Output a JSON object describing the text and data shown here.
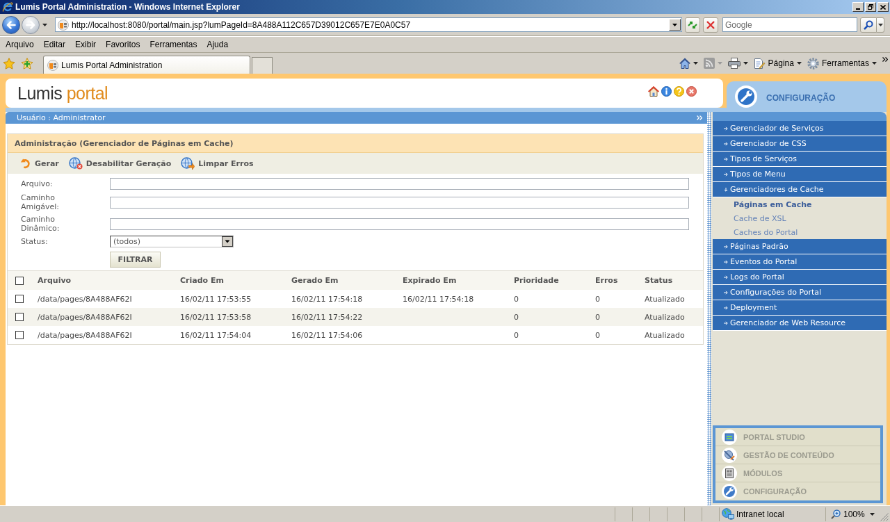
{
  "window": {
    "title": "Lumis Portal Administration - Windows Internet Explorer"
  },
  "address_bar": {
    "url": "http://localhost:8080/portal/main.jsp?lumPageId=8A488A112C657D39012C657E7E0A0C57"
  },
  "search_box": {
    "placeholder": "Google"
  },
  "menu_bar": [
    "Arquivo",
    "Editar",
    "Exibir",
    "Favoritos",
    "Ferramentas",
    "Ajuda"
  ],
  "tabs": [
    {
      "label": "Lumis Portal Administration",
      "selected": true
    }
  ],
  "command_bar": [
    "Página",
    "Ferramentas"
  ],
  "portal_header": {
    "logo": [
      "Lumis",
      "portal"
    ],
    "section": "CONFIGURAÇÃO"
  },
  "user_bar": {
    "text": "Usuário : Administrator"
  },
  "panel": {
    "title": "Administração (Gerenciador de Páginas em Cache)",
    "actions": [
      "Gerar",
      "Desabilitar Geração",
      "Limpar Erros"
    ],
    "filters": [
      {
        "kind": "text",
        "label": "Arquivo:"
      },
      {
        "kind": "text",
        "label": "Caminho Amigável:"
      },
      {
        "kind": "text",
        "label": "Caminho Dinâmico:"
      },
      {
        "kind": "select",
        "label": "Status:",
        "value": "(todos)"
      }
    ],
    "filter_button": "FILTRAR",
    "table": {
      "select_all": {
        "checked": false
      },
      "columns": [
        "Arquivo",
        "Criado Em",
        "Gerado Em",
        "Expirado Em",
        "Prioridade",
        "Erros",
        "Status"
      ],
      "rows": [
        {
          "checked": false,
          "file": "/data/pages/8A488AF62I",
          "created": "16/02/11 17:53:55",
          "generated": "16/02/11 17:54:18",
          "expires": "16/02/11 17:54:18",
          "priority": "0",
          "errors": "0",
          "status": "Atualizado"
        },
        {
          "checked": false,
          "file": "/data/pages/8A488AF62I",
          "created": "16/02/11 17:53:58",
          "generated": "16/02/11 17:54:22",
          "priority": "0",
          "errors": "0",
          "status": "Atualizado"
        },
        {
          "checked": false,
          "file": "/data/pages/8A488AF62I",
          "created": "16/02/11 17:54:04",
          "generated": "16/02/11 17:54:06",
          "priority": "0",
          "errors": "0",
          "status": "Atualizado"
        }
      ]
    }
  },
  "sidebar": {
    "items": [
      {
        "label": "Gerenciador de Serviços",
        "expanded": false
      },
      {
        "label": "Gerenciador de CSS",
        "expanded": false
      },
      {
        "label": "Tipos de Serviços",
        "expanded": false
      },
      {
        "label": "Tipos de Menu",
        "expanded": false
      },
      {
        "label": "Gerenciadores de Cache",
        "expanded": true,
        "children": [
          {
            "label": "Páginas em Cache",
            "selected": true
          },
          {
            "label": "Cache de XSL",
            "selected": false
          },
          {
            "label": "Caches do Portal",
            "selected": false
          }
        ]
      },
      {
        "label": "Páginas Padrão",
        "expanded": false
      },
      {
        "label": "Eventos do Portal",
        "expanded": false
      },
      {
        "label": "Logs do Portal",
        "expanded": false
      },
      {
        "label": "Configurações do Portal",
        "expanded": false
      },
      {
        "label": "Deployment",
        "expanded": false
      },
      {
        "label": "Gerenciador de Web Resource",
        "expanded": false
      }
    ]
  },
  "modules": [
    {
      "label": "PORTAL STUDIO"
    },
    {
      "label": "GESTÃO DE CONTEÚDO"
    },
    {
      "label": "MÓDULOS"
    },
    {
      "label": "CONFIGURAÇÃO"
    }
  ],
  "status_bar": {
    "zone": "Intranet local",
    "zoom": "100%"
  }
}
